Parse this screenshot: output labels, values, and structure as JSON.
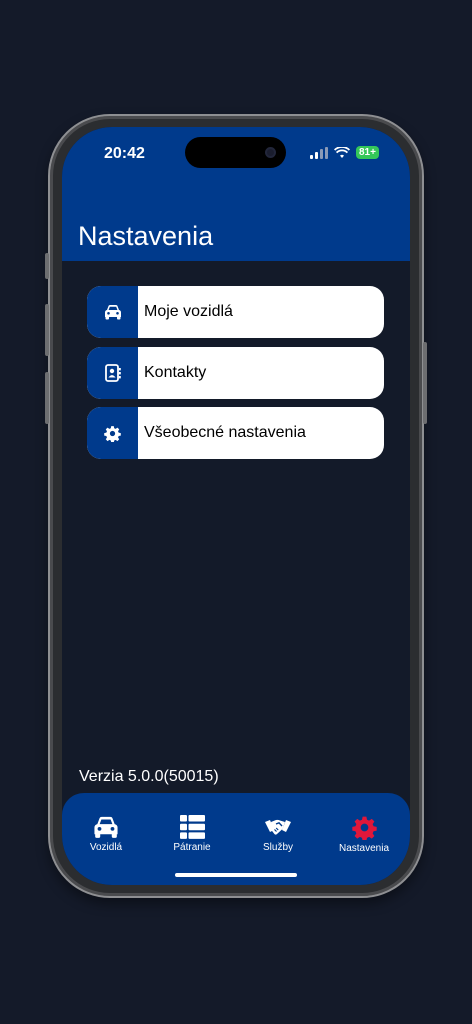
{
  "status": {
    "time": "20:42",
    "battery": "81+"
  },
  "header": {
    "title": "Nastavenia"
  },
  "menu": [
    {
      "label": "Moje vozidlá",
      "icon": "car-icon"
    },
    {
      "label": "Kontakty",
      "icon": "contacts-icon"
    },
    {
      "label": "Všeobecné nastavenia",
      "icon": "gear-icon"
    }
  ],
  "footer": {
    "version": "Verzia 5.0.0(50015)"
  },
  "tabbar": {
    "tabs": [
      {
        "label": "Vozidlá",
        "icon": "car-icon"
      },
      {
        "label": "Pátranie",
        "icon": "list-icon"
      },
      {
        "label": "Služby",
        "icon": "handshake-icon"
      },
      {
        "label": "Nastavenia",
        "icon": "gear-icon",
        "active": true
      }
    ],
    "active_color": "#e0173a"
  },
  "colors": {
    "brand": "#003a8c",
    "background": "#131a29"
  }
}
